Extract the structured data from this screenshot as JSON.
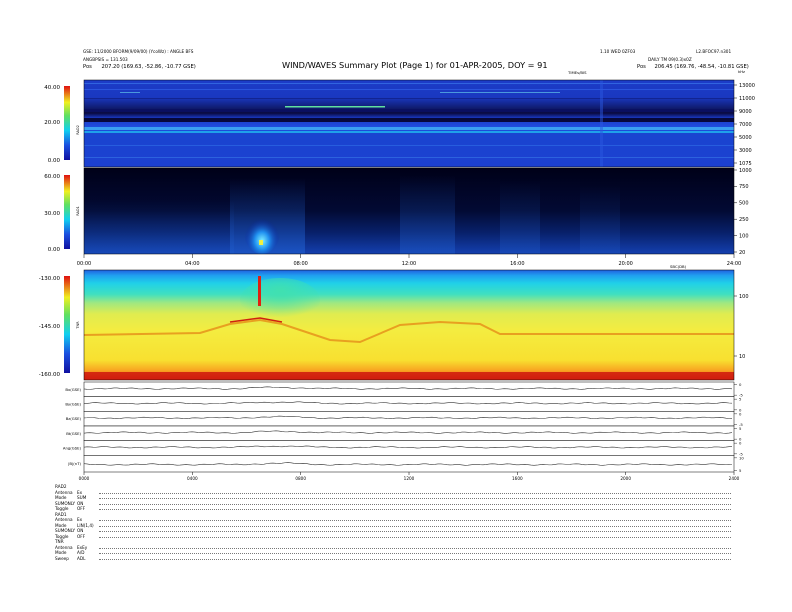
{
  "header": {
    "title": "WIND/WAVES Summary Plot (Page 1) for 01-APR-2005, DOY = 91",
    "left_line1": "GSE: 11/2000 BFORM(9/09/00) (YcoWz) : ANGLE BFS",
    "left_line2": "ANGBPSIS = 131.503",
    "left_line3_label": "Pos",
    "left_line3_value": "207.20 (169.63, -52.86, -10.77 GSE)",
    "right_line1": "1.10 WED 0ZF03",
    "right_line1b": "L2.BFOC97.n301",
    "right_line2": "DAILY TM 09(0.3)x0Z",
    "right_line3_label": "Pos",
    "right_line3_value": "206.45 (169.76, -48.54, -10.81 GSE)"
  },
  "chart_data": [
    {
      "type": "heatmap",
      "name": "RAD2",
      "ylabel": "RAD2",
      "colorbar_ticks": [
        "40.00",
        "20.00",
        "0.00"
      ],
      "colorbar_range": [
        0,
        40
      ],
      "freq_unit": "kHz",
      "freq_ticks": [
        "13000",
        "11000",
        "9000",
        "7000",
        "5000",
        "3000",
        "1075"
      ],
      "description": "Quiet high-frequency background with narrowband radio lines"
    },
    {
      "type": "heatmap",
      "name": "RAD1",
      "ylabel": "RAD1",
      "colorbar_ticks": [
        "60.00",
        "30.00",
        "0.00"
      ],
      "colorbar_range": [
        0,
        60
      ],
      "freq_ticks": [
        "1000",
        "750",
        "500",
        "250",
        "100",
        "20"
      ],
      "time_ticks": [
        "00:00",
        "04:00",
        "08:00",
        "12:00",
        "16:00",
        "20:00",
        "24:00"
      ],
      "tick_label_top": "TIMEs/BIS"
    },
    {
      "type": "heatmap",
      "name": "TNR",
      "ylabel": "TNR",
      "colorbar_ticks": [
        "-130.00",
        "-145.00",
        "-160.00"
      ],
      "colorbar_range": [
        -160,
        -130
      ],
      "freq_unit": "SBC(DB)",
      "freq_ticks": [
        "100",
        "10"
      ]
    },
    {
      "type": "line",
      "name": "magnetic-field",
      "panels": [
        {
          "label": "Bx(GSE)",
          "ticks": [
            "0",
            "-5"
          ]
        },
        {
          "label": "By(GSE)",
          "ticks": [
            "5",
            "0"
          ]
        },
        {
          "label": "Bz(GSE)",
          "ticks": [
            "0",
            "-5"
          ]
        },
        {
          "label": "Bt(GSE)",
          "ticks": [
            "5",
            "0"
          ]
        },
        {
          "label": "Ang(GSE)",
          "ticks": [
            "0",
            "-5"
          ]
        },
        {
          "label": "|B|(nT)",
          "ticks": [
            "10",
            "5"
          ]
        }
      ],
      "time_ticks": [
        "0000",
        "0400",
        "0800",
        "1200",
        "1600",
        "2000",
        "2400"
      ]
    }
  ],
  "footer": [
    {
      "header": "RAD2",
      "rows": [
        {
          "label": "Antenna",
          "value": "Ex"
        },
        {
          "label": "Mode",
          "value": "SUM"
        },
        {
          "label": "SUMONLY",
          "value": "ON"
        },
        {
          "label": "Toggle",
          "value": "OFF"
        }
      ]
    },
    {
      "header": "RAD1",
      "rows": [
        {
          "label": "Antenna",
          "value": "Ex"
        },
        {
          "label": "Mode",
          "value": "LIN(1,4)"
        },
        {
          "label": "SUMONLY",
          "value": "ON"
        },
        {
          "label": "Toggle",
          "value": "OFF"
        }
      ]
    },
    {
      "header": "TNR",
      "rows": [
        {
          "label": "Antenna",
          "value": "ExEy"
        },
        {
          "label": "Mode",
          "value": "A/D"
        },
        {
          "label": "Sweep",
          "value": "ADL"
        }
      ]
    }
  ],
  "colors": {
    "background": "#ffffff",
    "spectrogram_dark": "#00005a",
    "tnr_yellow": "#f4ec32",
    "tnr_cyan": "#20c8e0",
    "tnr_red": "#d22010"
  }
}
